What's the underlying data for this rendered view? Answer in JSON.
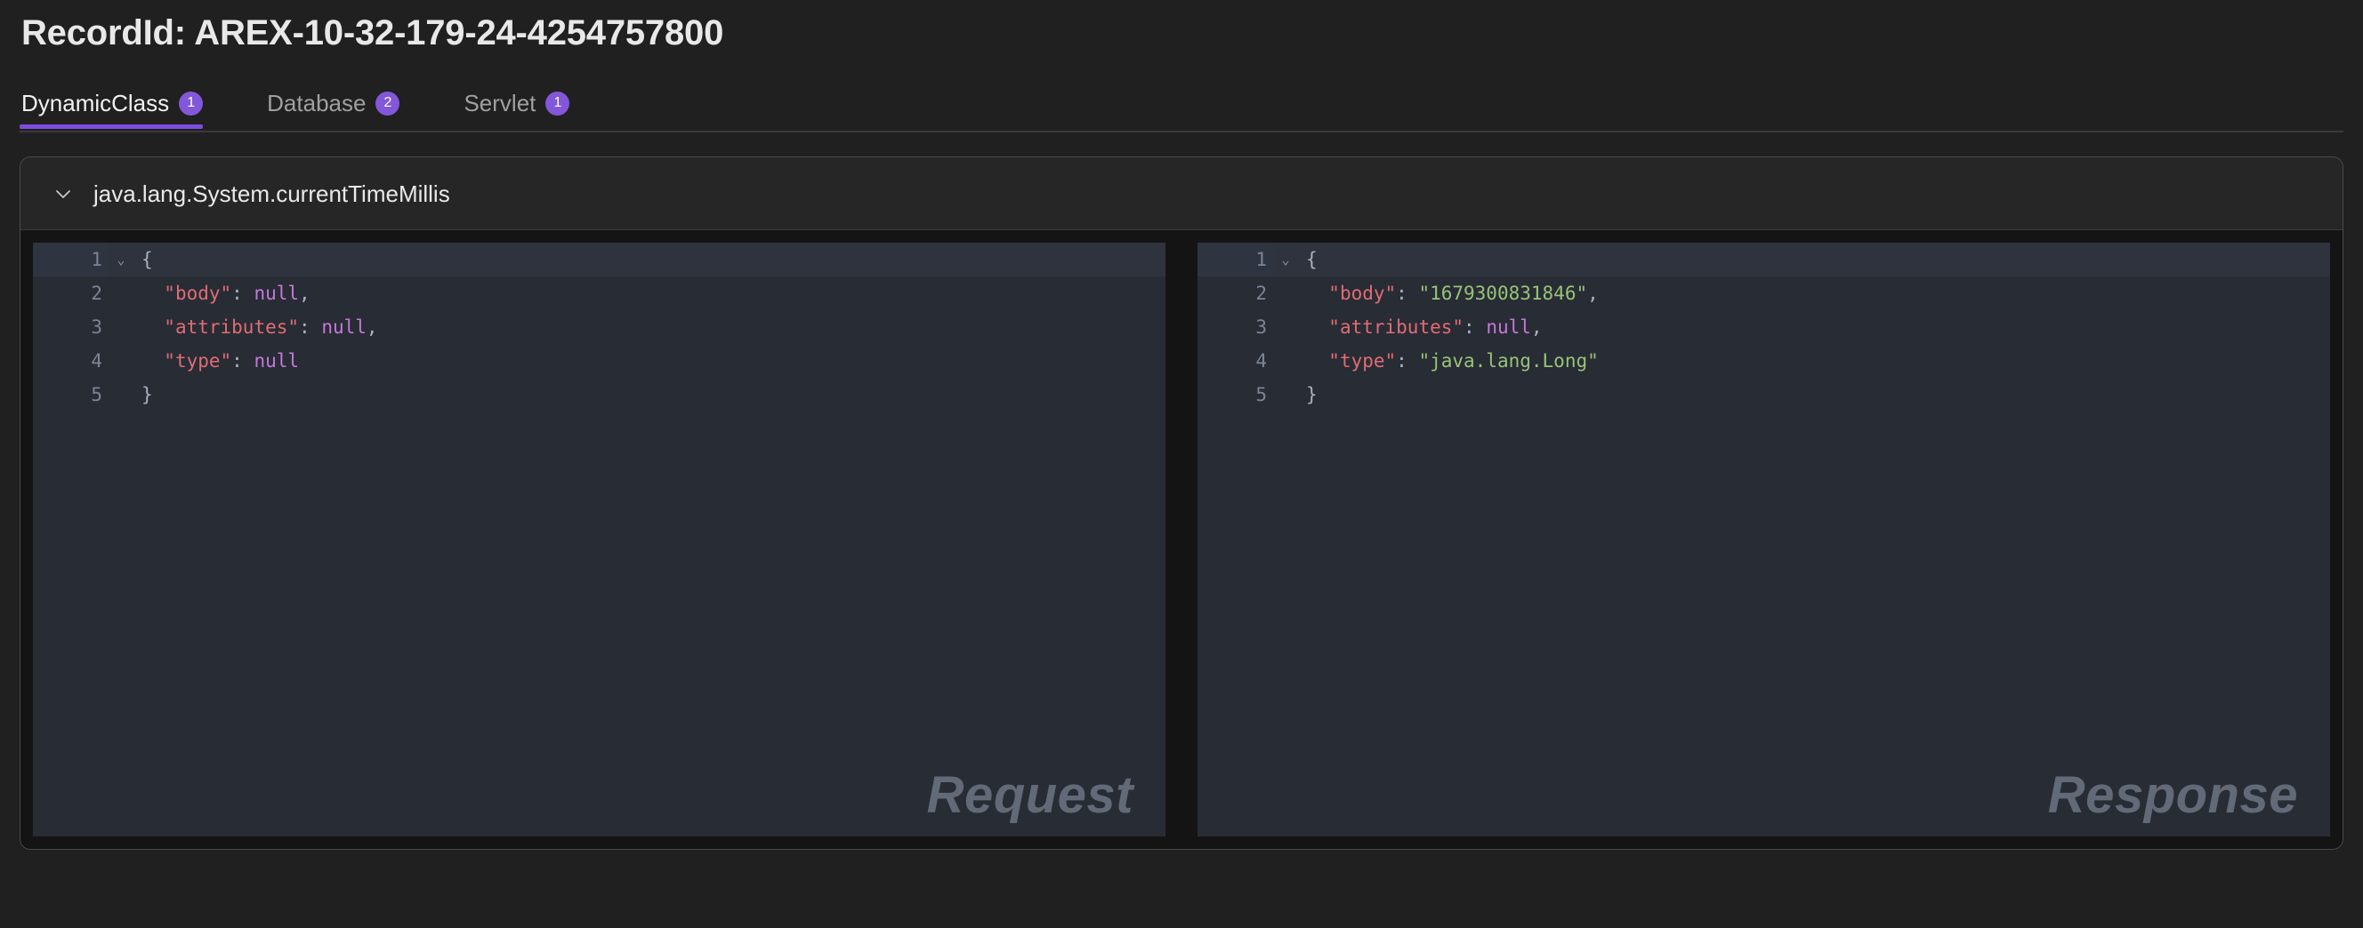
{
  "header": {
    "record_title": "RecordId: AREX-10-32-179-24-4254757800"
  },
  "tabs": [
    {
      "label": "DynamicClass",
      "count": "1",
      "active": true
    },
    {
      "label": "Database",
      "count": "2",
      "active": false
    },
    {
      "label": "Servlet",
      "count": "1",
      "active": false
    }
  ],
  "card": {
    "title": "java.lang.System.currentTimeMillis",
    "expanded": true,
    "chevron_icon": "chevron-down-icon"
  },
  "editors": {
    "request": {
      "watermark": "Request",
      "lines": [
        {
          "num": "1",
          "foldable": true,
          "tokens": [
            {
              "t": "punc",
              "v": "{"
            }
          ]
        },
        {
          "num": "2",
          "foldable": false,
          "tokens": [
            {
              "t": "punc",
              "v": "  "
            },
            {
              "t": "key",
              "v": "\"body\""
            },
            {
              "t": "punc",
              "v": ": "
            },
            {
              "t": "null",
              "v": "null"
            },
            {
              "t": "punc",
              "v": ","
            }
          ]
        },
        {
          "num": "3",
          "foldable": false,
          "tokens": [
            {
              "t": "punc",
              "v": "  "
            },
            {
              "t": "key",
              "v": "\"attributes\""
            },
            {
              "t": "punc",
              "v": ": "
            },
            {
              "t": "null",
              "v": "null"
            },
            {
              "t": "punc",
              "v": ","
            }
          ]
        },
        {
          "num": "4",
          "foldable": false,
          "tokens": [
            {
              "t": "punc",
              "v": "  "
            },
            {
              "t": "key",
              "v": "\"type\""
            },
            {
              "t": "punc",
              "v": ": "
            },
            {
              "t": "null",
              "v": "null"
            }
          ]
        },
        {
          "num": "5",
          "foldable": false,
          "tokens": [
            {
              "t": "punc",
              "v": "}"
            }
          ]
        }
      ]
    },
    "response": {
      "watermark": "Response",
      "lines": [
        {
          "num": "1",
          "foldable": true,
          "tokens": [
            {
              "t": "punc",
              "v": "{"
            }
          ]
        },
        {
          "num": "2",
          "foldable": false,
          "tokens": [
            {
              "t": "punc",
              "v": "  "
            },
            {
              "t": "key",
              "v": "\"body\""
            },
            {
              "t": "punc",
              "v": ": "
            },
            {
              "t": "string",
              "v": "\"1679300831846\""
            },
            {
              "t": "punc",
              "v": ","
            }
          ]
        },
        {
          "num": "3",
          "foldable": false,
          "tokens": [
            {
              "t": "punc",
              "v": "  "
            },
            {
              "t": "key",
              "v": "\"attributes\""
            },
            {
              "t": "punc",
              "v": ": "
            },
            {
              "t": "null",
              "v": "null"
            },
            {
              "t": "punc",
              "v": ","
            }
          ]
        },
        {
          "num": "4",
          "foldable": false,
          "tokens": [
            {
              "t": "punc",
              "v": "  "
            },
            {
              "t": "key",
              "v": "\"type\""
            },
            {
              "t": "punc",
              "v": ": "
            },
            {
              "t": "string",
              "v": "\"java.lang.Long\""
            }
          ]
        },
        {
          "num": "5",
          "foldable": false,
          "tokens": [
            {
              "t": "punc",
              "v": "}"
            }
          ]
        }
      ]
    }
  },
  "colors": {
    "page_background": "#202020",
    "accent_purple": "#7c4dde",
    "badge_purple": "#8257d9",
    "editor_background": "#282c34",
    "key_color": "#e06c75",
    "null_color": "#c678dd",
    "string_color": "#98c379",
    "punctuation_color": "#a9b2c0",
    "watermark_color": "#626a77"
  }
}
